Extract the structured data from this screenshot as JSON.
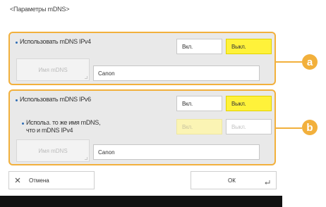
{
  "screen": {
    "title": "<Параметры mDNS>"
  },
  "ipv4": {
    "label": "Использовать mDNS IPv4",
    "on_label": "Вкл.",
    "off_label": "Выкл.",
    "name_button_label": "Имя mDNS",
    "name_value": "Canon",
    "callout": "a",
    "selected": "off"
  },
  "ipv6": {
    "label": "Использовать mDNS IPv6",
    "on_label": "Вкл.",
    "off_label": "Выкл.",
    "same_name_label_line1": "Использ. то же имя mDNS,",
    "same_name_label_line2": "что и mDNS IPv4",
    "same_on_label": "Вкл.",
    "same_off_label": "Выкл.",
    "name_button_label": "Имя mDNS",
    "name_value": "Canon",
    "callout": "b",
    "selected": "off"
  },
  "footer": {
    "cancel_label": "Отмена",
    "ok_label": "ОК"
  },
  "colors": {
    "accent": "#f2b03c",
    "selected": "#fff23a",
    "panel": "#e9e9e9",
    "bullet": "#2f6db5"
  }
}
